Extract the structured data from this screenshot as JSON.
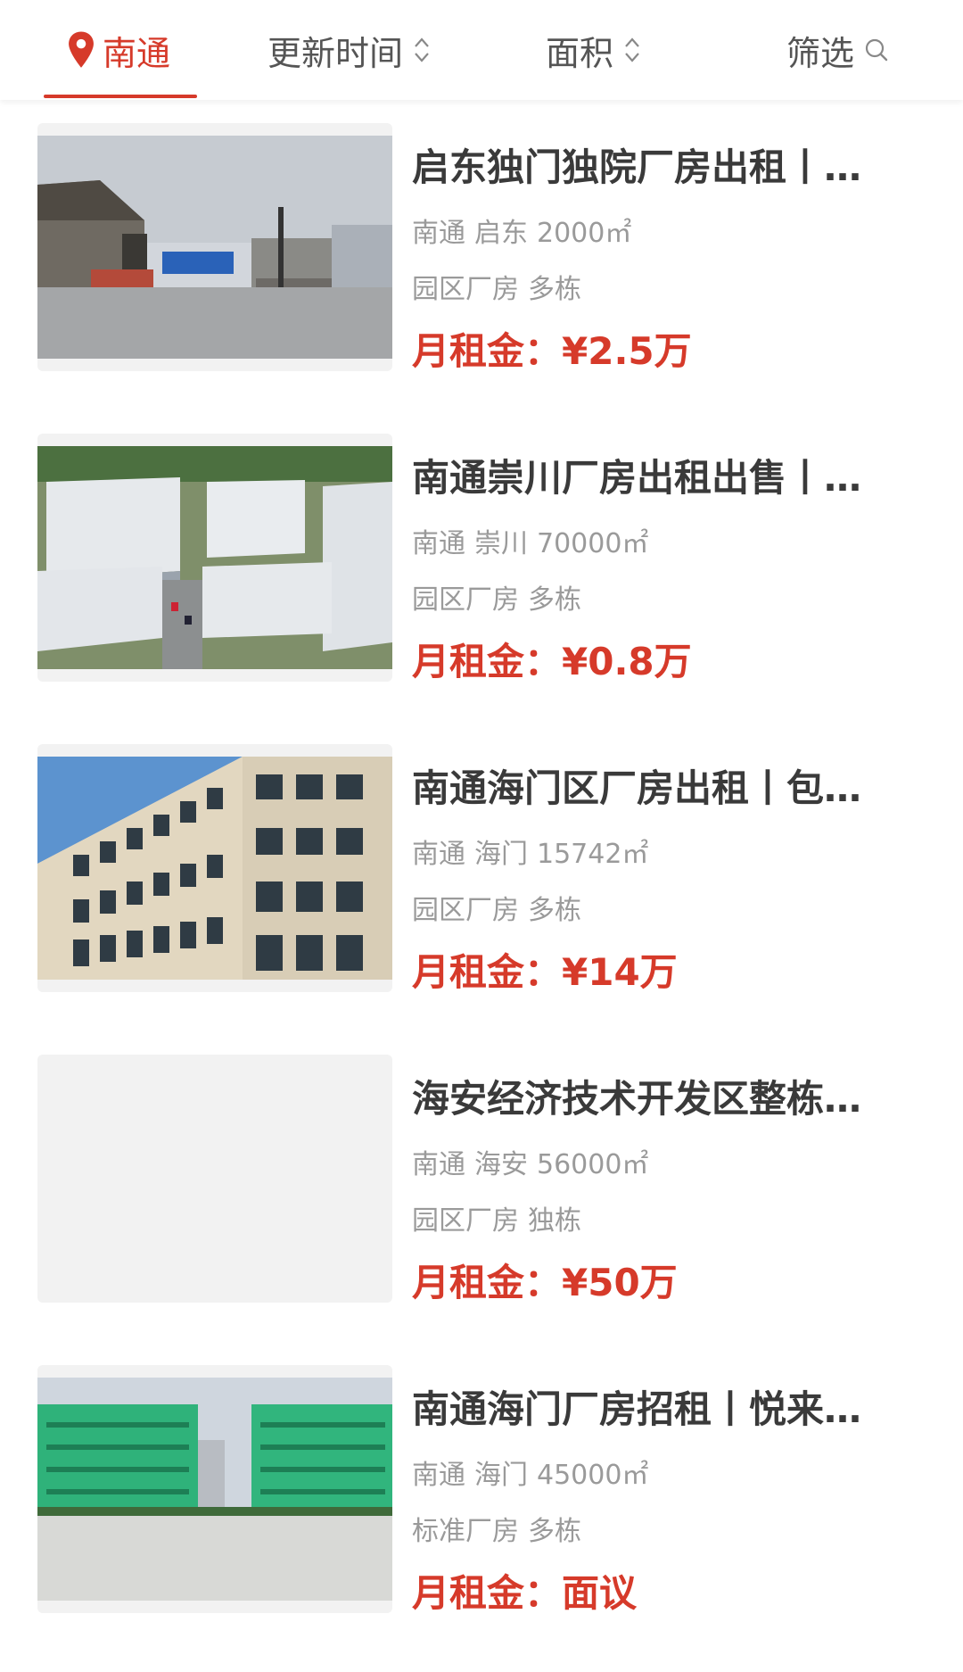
{
  "filter_bar": {
    "city": "南通",
    "sort_update": "更新时间",
    "sort_area": "面积",
    "filter": "筛选"
  },
  "listings": [
    {
      "title": "启东独门独院厂房出租丨厂房带办公楼",
      "city": "南通",
      "district": "启东",
      "area": "2000㎡",
      "tag1": "园区厂房",
      "tag2": "多栋",
      "price_label": "月租金：",
      "price": "¥2.5万"
    },
    {
      "title": "南通崇川厂房出租出售丨园区厂房",
      "city": "南通",
      "district": "崇川",
      "area": "70000㎡",
      "tag1": "园区厂房",
      "tag2": "多栋",
      "price_label": "月租金：",
      "price": "¥0.8万"
    },
    {
      "title": "南通海门区厂房出租丨包办证照",
      "city": "南通",
      "district": "海门",
      "area": "15742㎡",
      "tag1": "园区厂房",
      "tag2": "多栋",
      "price_label": "月租金：",
      "price": "¥14万"
    },
    {
      "title": "海安经济技术开发区整栋厂房出租",
      "city": "南通",
      "district": "海安",
      "area": "56000㎡",
      "tag1": "园区厂房",
      "tag2": "独栋",
      "price_label": "月租金：",
      "price": "¥50万"
    },
    {
      "title": "南通海门厂房招租丨悦来镇园区",
      "city": "南通",
      "district": "海门",
      "area": "45000㎡",
      "tag1": "标准厂房",
      "tag2": "多栋",
      "price_label": "月租金：",
      "price": "面议"
    }
  ]
}
